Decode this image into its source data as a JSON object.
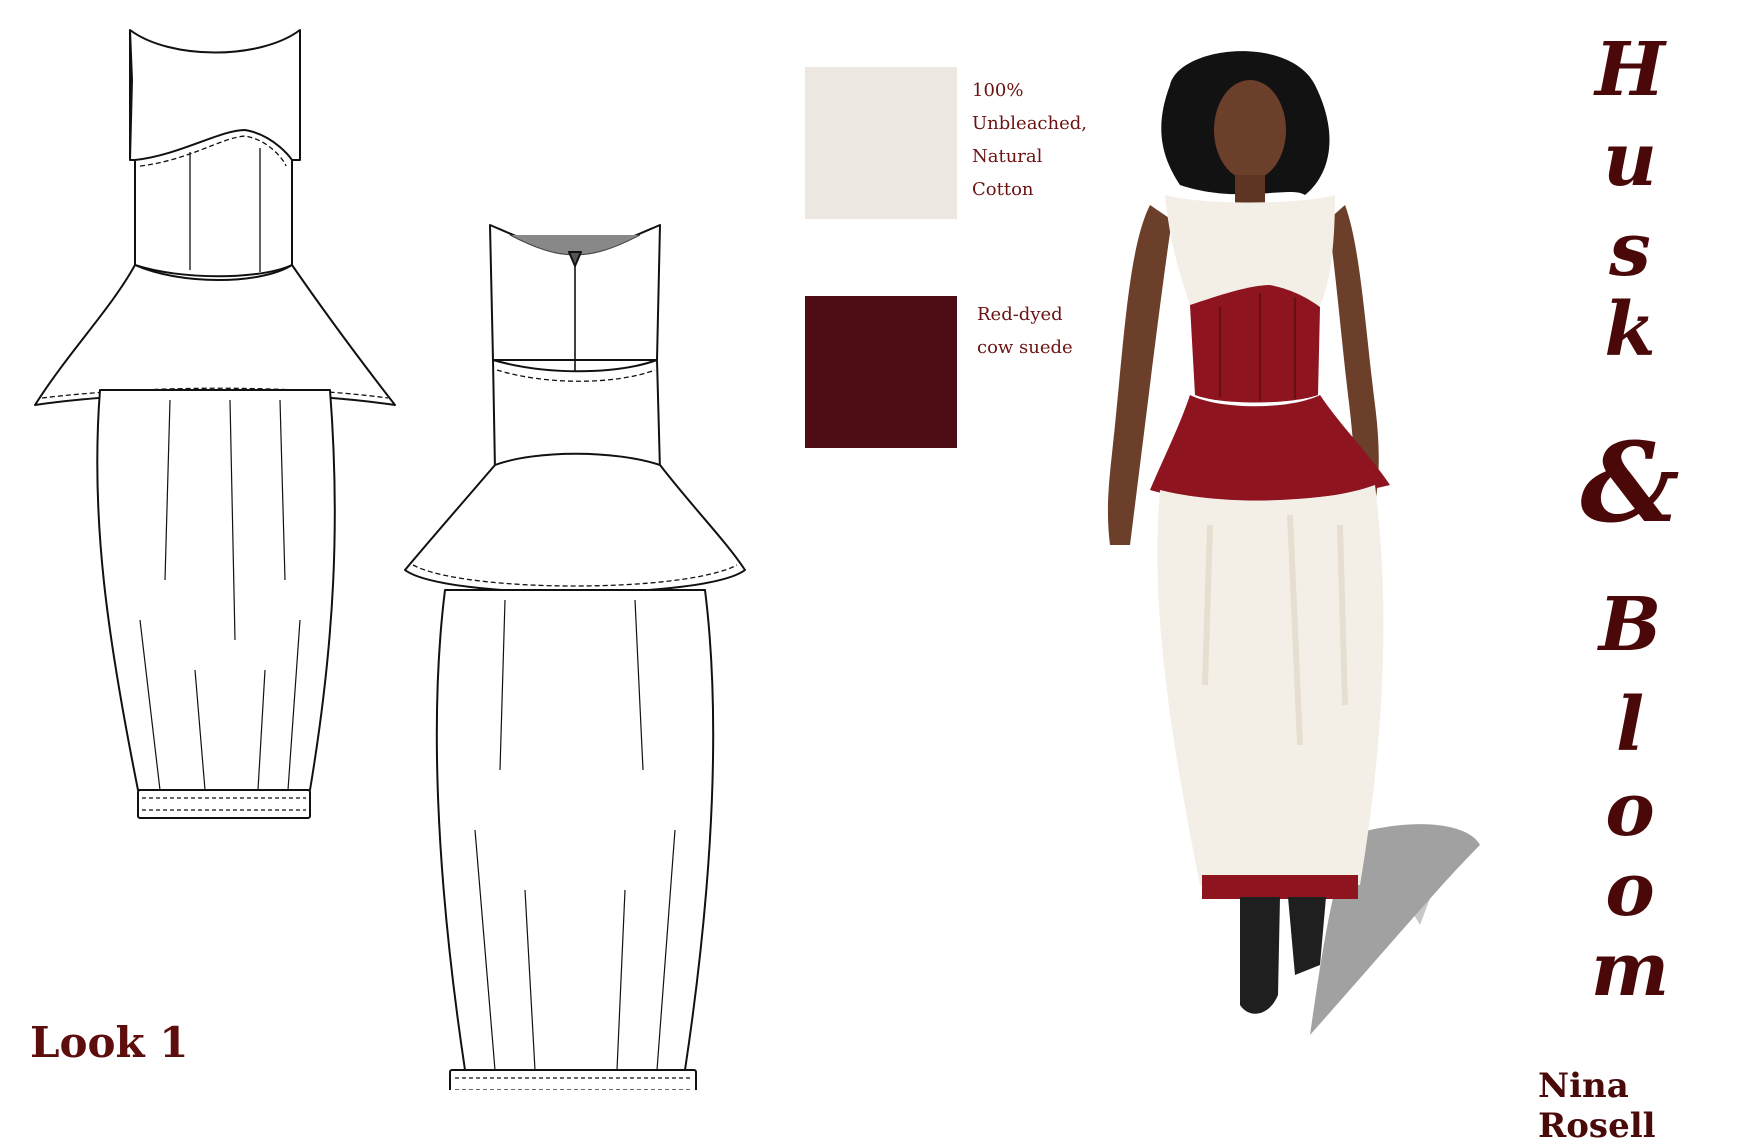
{
  "board": {
    "look_label": "Look 1",
    "designer": "Nina Rosell",
    "title_letters": [
      "H",
      "u",
      "s",
      "k",
      "&",
      "B",
      "l",
      "o",
      "o",
      "m"
    ]
  },
  "fabrics": [
    {
      "name": "cotton-swatch",
      "color": "#ece7e0",
      "label_lines": [
        "100%",
        "Unbleached,",
        "Natural",
        "Cotton"
      ]
    },
    {
      "name": "suede-swatch",
      "color": "#4e0d14",
      "label_lines": [
        "Red-dyed",
        "cow suede"
      ]
    }
  ],
  "colors": {
    "accent": "#5e0d0d",
    "suede": "#8e1420",
    "cotton": "#f4efe6",
    "skin": "#6b3f2a",
    "hair": "#121212",
    "boot": "#1f1f1f"
  }
}
